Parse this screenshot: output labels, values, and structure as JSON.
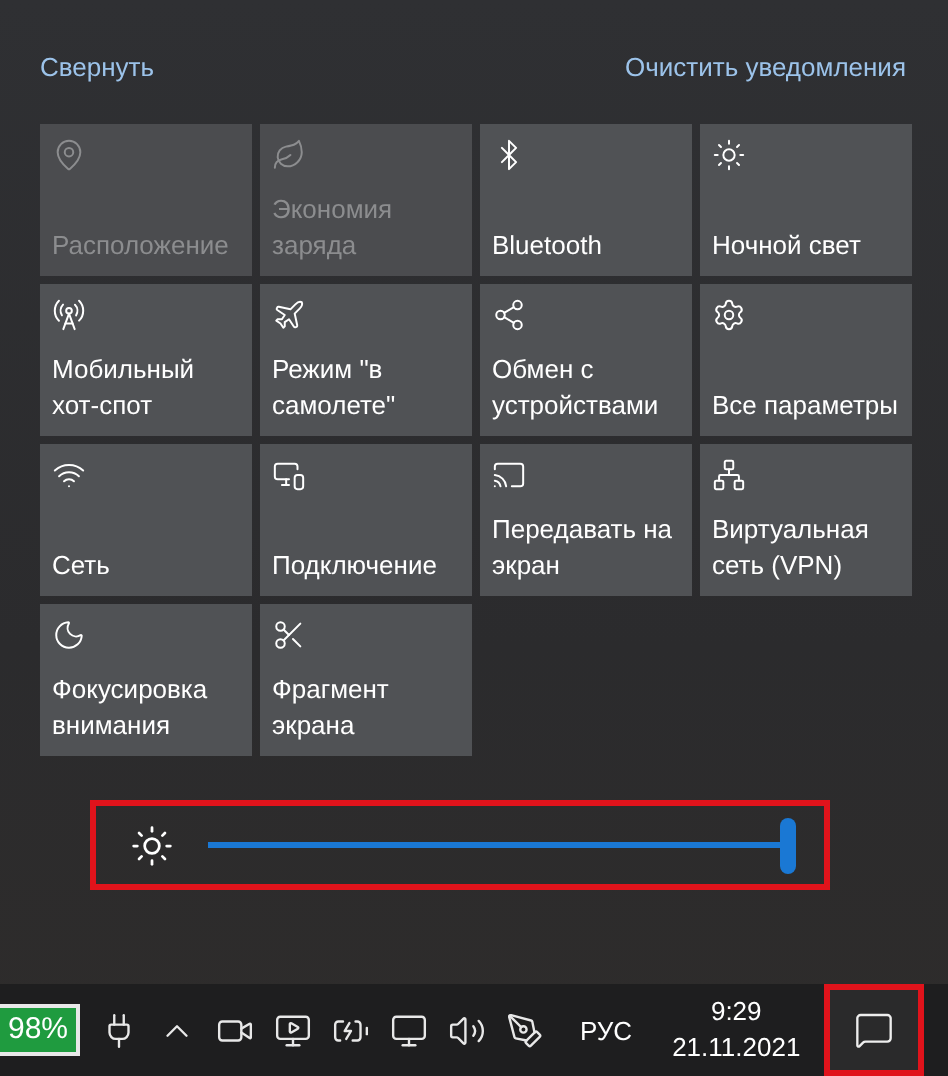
{
  "header": {
    "collapse": "Свернуть",
    "clear": "Очистить уведомления"
  },
  "tiles": [
    {
      "label": "Расположение",
      "disabled": true
    },
    {
      "label": "Экономия заряда",
      "disabled": true
    },
    {
      "label": "Bluetooth",
      "disabled": false
    },
    {
      "label": "Ночной свет",
      "disabled": false
    },
    {
      "label": "Мобильный хот-спот",
      "disabled": false
    },
    {
      "label": "Режим \"в самолете\"",
      "disabled": false
    },
    {
      "label": "Обмен с устройствами",
      "disabled": false
    },
    {
      "label": "Все параметры",
      "disabled": false
    },
    {
      "label": "Сеть",
      "disabled": false
    },
    {
      "label": "Подключение",
      "disabled": false
    },
    {
      "label": "Передавать на экран",
      "disabled": false
    },
    {
      "label": "Виртуальная сеть (VPN)",
      "disabled": false
    },
    {
      "label": "Фокусировка внимания",
      "disabled": false
    },
    {
      "label": "Фрагмент экрана",
      "disabled": false
    }
  ],
  "brightness": {
    "level": 1
  },
  "taskbar": {
    "battery": "98%",
    "language": "РУС",
    "time": "9:29",
    "date": "21.11.2021"
  }
}
